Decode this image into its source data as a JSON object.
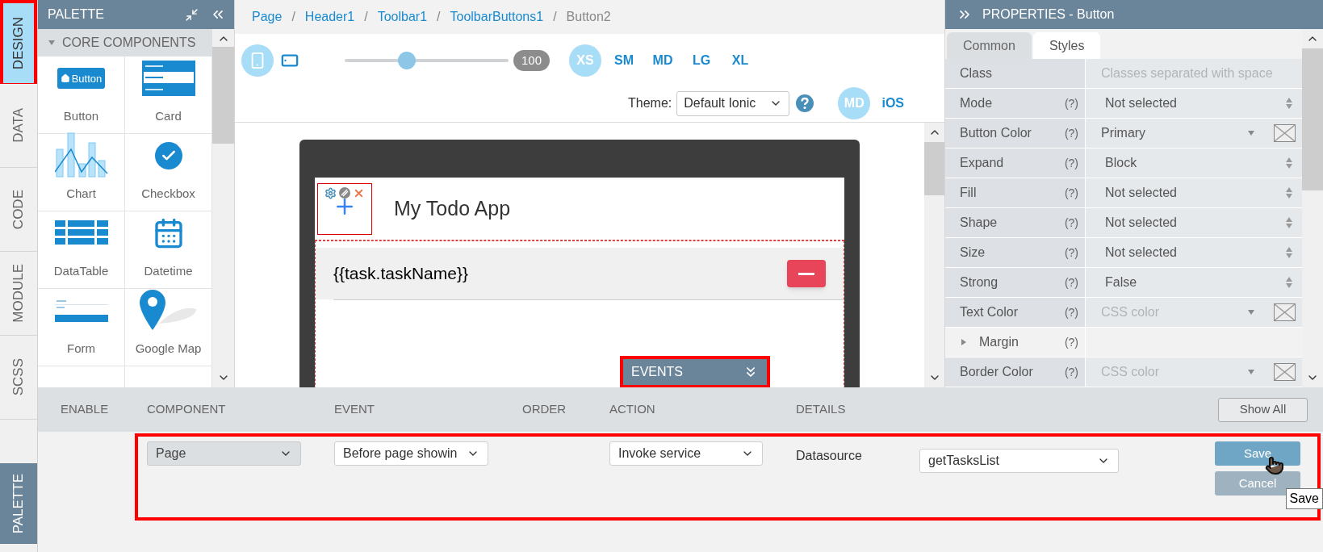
{
  "left_tabs": [
    {
      "label": "DESIGN",
      "selected": true
    },
    {
      "label": "DATA",
      "selected": false
    },
    {
      "label": "CODE",
      "selected": false
    },
    {
      "label": "MODULE",
      "selected": false
    },
    {
      "label": "SCSS",
      "selected": false
    }
  ],
  "palette_tab": {
    "label": "PALETTE"
  },
  "palette": {
    "title": "PALETTE",
    "section": {
      "label": "CORE COMPONENTS",
      "expanded": true
    },
    "items": [
      {
        "label": "Button",
        "kind": "button",
        "preview_text": "Button"
      },
      {
        "label": "Card",
        "kind": "card"
      },
      {
        "label": "Chart",
        "kind": "chart"
      },
      {
        "label": "Checkbox",
        "kind": "checkbox"
      },
      {
        "label": "DataTable",
        "kind": "datatable"
      },
      {
        "label": "Datetime",
        "kind": "datetime"
      },
      {
        "label": "Form",
        "kind": "form"
      },
      {
        "label": "Google Map",
        "kind": "map"
      }
    ]
  },
  "breadcrumb": [
    {
      "label": "Page",
      "current": false
    },
    {
      "separator": "/",
      "label": "Header1",
      "current": false
    },
    {
      "separator": "/",
      "label": "Toolbar1",
      "current": false
    },
    {
      "separator": "/",
      "label": "ToolbarButtons1",
      "current": false
    },
    {
      "separator": "/",
      "label": "Button2",
      "current": true
    }
  ],
  "toolbar": {
    "devices": [
      {
        "kind": "phone",
        "selected": true
      },
      {
        "kind": "tablet",
        "selected": false
      }
    ],
    "zoom": {
      "level": 0.38,
      "reading": "100"
    },
    "sizes": [
      {
        "label": "XS",
        "selected": true
      },
      {
        "label": "SM",
        "selected": false
      },
      {
        "label": "MD",
        "selected": false
      },
      {
        "label": "LG",
        "selected": false
      },
      {
        "label": "XL",
        "selected": false
      }
    ],
    "theme": {
      "label": "Theme:",
      "value": "Default Ionic"
    },
    "modes": [
      {
        "label": "MD",
        "selected": true
      },
      {
        "label": "iOS",
        "selected": false
      }
    ]
  },
  "canvas": {
    "title": "My Todo App",
    "item": "{{task.taskName}}",
    "events_button": "EVENTS"
  },
  "properties": {
    "title": "PROPERTIES - Button",
    "tabs": [
      {
        "label": "Common",
        "selected": false
      },
      {
        "label": "Styles",
        "selected": true
      }
    ],
    "rows": [
      {
        "label": "Class",
        "kind": "text",
        "placeholder": "Classes separated with space"
      },
      {
        "label": "Mode",
        "help": "(?)",
        "kind": "select",
        "value": "Not selected"
      },
      {
        "label": "Button Color",
        "help": "(?)",
        "kind": "color",
        "value": "Primary"
      },
      {
        "label": "Expand",
        "help": "(?)",
        "kind": "select",
        "value": "Block"
      },
      {
        "label": "Fill",
        "help": "(?)",
        "kind": "select",
        "value": "Not selected"
      },
      {
        "label": "Shape",
        "help": "(?)",
        "kind": "select",
        "value": "Not selected"
      },
      {
        "label": "Size",
        "help": "(?)",
        "kind": "select",
        "value": "Not selected"
      },
      {
        "label": "Strong",
        "help": "(?)",
        "kind": "select",
        "value": "False"
      },
      {
        "label": "Text Color",
        "help": "(?)",
        "kind": "color",
        "placeholder": "CSS color"
      },
      {
        "label": "Margin",
        "help": "(?)",
        "kind": "group",
        "expanded": false
      },
      {
        "label": "Border Color",
        "help": "(?)",
        "kind": "color",
        "placeholder": "CSS color"
      }
    ]
  },
  "events": {
    "columns": [
      "ENABLE",
      "COMPONENT",
      "EVENT",
      "ORDER",
      "ACTION",
      "DETAILS"
    ],
    "show_all": "Show All",
    "row": {
      "component": {
        "value": "Page",
        "disabled": true
      },
      "event": {
        "value": "Before page showin",
        "disabled": false
      },
      "action": {
        "value": "Invoke service",
        "disabled": false
      },
      "detail_label": "Datasource",
      "detail_value": "getTasksList",
      "save": "Save",
      "cancel": "Cancel"
    },
    "tooltip": "Save"
  }
}
